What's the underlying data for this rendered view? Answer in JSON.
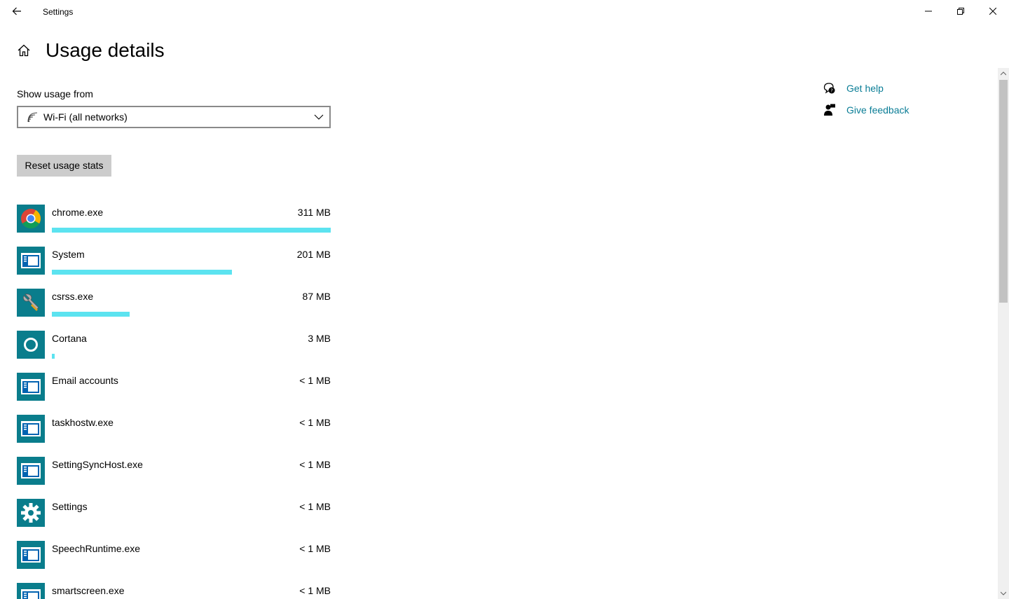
{
  "window": {
    "title": "Settings"
  },
  "header": {
    "page_title": "Usage details"
  },
  "usage_source": {
    "label": "Show usage from",
    "selected": "Wi-Fi (all networks)",
    "icon": "wifi-icon"
  },
  "reset_button": {
    "label": "Reset usage stats"
  },
  "apps": [
    {
      "name": "chrome.exe",
      "usage": "311 MB",
      "usage_fraction": 1.0,
      "icon": "chrome-icon"
    },
    {
      "name": "System",
      "usage": "201 MB",
      "usage_fraction": 0.646,
      "icon": "app-window-icon"
    },
    {
      "name": "csrss.exe",
      "usage": "87 MB",
      "usage_fraction": 0.28,
      "icon": "wrench-icon"
    },
    {
      "name": "Cortana",
      "usage": "3 MB",
      "usage_fraction": 0.01,
      "icon": "cortana-icon"
    },
    {
      "name": "Email accounts",
      "usage": "< 1 MB",
      "usage_fraction": 0,
      "icon": "app-window-icon"
    },
    {
      "name": "taskhostw.exe",
      "usage": "< 1 MB",
      "usage_fraction": 0,
      "icon": "app-window-icon"
    },
    {
      "name": "SettingSyncHost.exe",
      "usage": "< 1 MB",
      "usage_fraction": 0,
      "icon": "app-window-icon"
    },
    {
      "name": "Settings",
      "usage": "< 1 MB",
      "usage_fraction": 0,
      "icon": "gear-icon"
    },
    {
      "name": "SpeechRuntime.exe",
      "usage": "< 1 MB",
      "usage_fraction": 0,
      "icon": "app-window-icon"
    },
    {
      "name": "smartscreen.exe",
      "usage": "< 1 MB",
      "usage_fraction": 0,
      "icon": "app-window-icon"
    }
  ],
  "help": {
    "get_help": "Get help",
    "give_feedback": "Give feedback"
  },
  "colors": {
    "accent": "#0a7d96",
    "tile": "#0a7d8c",
    "bar": "#5ce3f0"
  }
}
